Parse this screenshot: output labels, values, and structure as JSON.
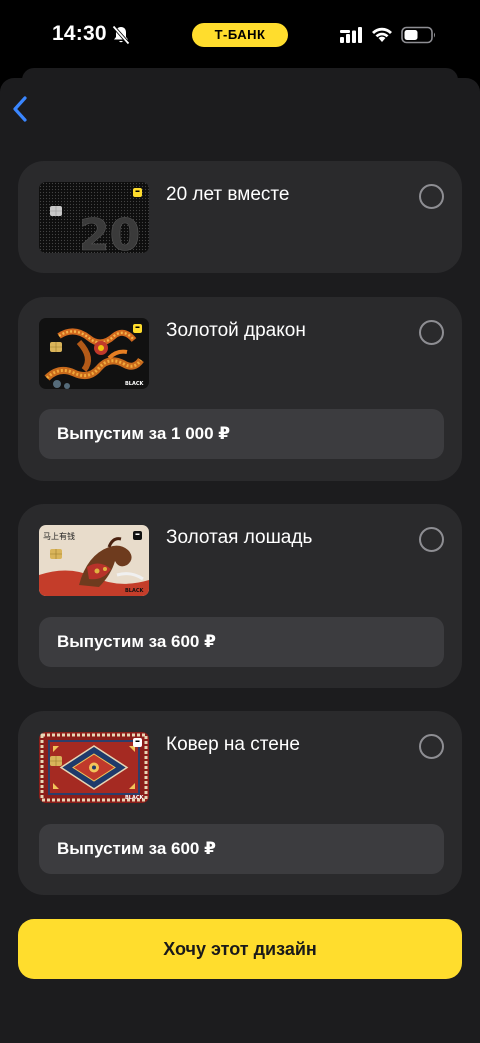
{
  "status_bar": {
    "time": "14:30",
    "bank_label": "Т-БАНК"
  },
  "back_icon": "chevron-left-icon",
  "designs": [
    {
      "title": "20 лет вместе",
      "price": null
    },
    {
      "title": "Золотой дракон",
      "price": "Выпустим за 1 000 ₽"
    },
    {
      "title": "Золотая лошадь",
      "price": "Выпустим за 600 ₽"
    },
    {
      "title": "Ковер на стене",
      "price": "Выпустим за 600 ₽"
    }
  ],
  "card_brand": "BLACK",
  "cta_label": "Хочу этот дизайн",
  "colors": {
    "accent": "#ffdd2d",
    "background": "#1c1c1e",
    "card": "#2a2a2c",
    "price_box": "#3c3c3f",
    "back_arrow": "#3a86ff"
  }
}
